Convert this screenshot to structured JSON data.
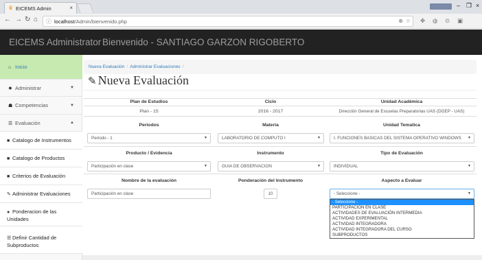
{
  "browser": {
    "tab_title": "EICEMS Admin",
    "tab_close": "×",
    "url_host": "localhost",
    "url_path": "/Admin/bienvenido.php",
    "min": "–",
    "max": "❐",
    "close": "×"
  },
  "navbar": {
    "brand": "EICEMS Administrator",
    "welcome": "Bienvenido - SANTIAGO GARZON RIGOBERTO"
  },
  "sidebar": {
    "items": [
      {
        "label": "Inicio",
        "icon": "home-icon"
      },
      {
        "label": "Administrar",
        "icon": "gear-icon"
      },
      {
        "label": "Competencias",
        "icon": "users-icon"
      },
      {
        "label": "Evaluación",
        "icon": "list-icon"
      },
      {
        "label": "Catalogo de Instrumentos",
        "icon": "book-icon"
      },
      {
        "label": "Catalogo de Productos",
        "icon": "book-icon"
      },
      {
        "label": "Criterios de Evaluación",
        "icon": "book-icon"
      },
      {
        "label": "Administrar Evaluaciones",
        "icon": "edit-icon"
      },
      {
        "label": "Ponderacion de las Unidades",
        "icon": "circle-icon"
      },
      {
        "label": "Definir Cantidad de Subproductos",
        "icon": "list-icon"
      }
    ]
  },
  "breadcrumb": {
    "items": [
      "Nueva Evaluación",
      "Administrar Evaluaciones"
    ],
    "sep": "/"
  },
  "page": {
    "title": "Nueva Evaluación"
  },
  "form": {
    "row1": {
      "headers": [
        "Plan de Estudios",
        "Ciclo",
        "Unidad Académica"
      ],
      "values": [
        "Plan - 15",
        "2016 - 2017",
        "Dirección General de Escuelas Preparatorias UAS (DGEP - UAS)"
      ]
    },
    "row2": {
      "headers": [
        "Periodos",
        "Materia",
        "Unidad Tematica"
      ],
      "selects": [
        "Periodo - 1",
        "LABORATORIO DE COMPUTO I",
        "I. FUNCIONES BASICAS DEL SISTEMA OPERATIVO WINDOWS"
      ]
    },
    "row3": {
      "headers": [
        "Producto / Evidencia",
        "Instrumento",
        "Tipo de Evaluación"
      ],
      "selects": [
        "Participación en clase",
        "GUIA DE OBSERVACION",
        "INDIVIDUAL"
      ]
    },
    "row4": {
      "headers": [
        "Nombre de la evaluación",
        "Ponderación del Instrumento",
        "Aspecto a Evaluar"
      ],
      "name_value": "Participación en clase",
      "ponderacion_value": "10",
      "aspecto_value": "- Seleccione -"
    }
  },
  "aspecto_options": [
    "- Seleccione -",
    "PARTICIPACION EN CLASE",
    "ACTIVIDADES DE EVALUACIÓN INTERMEDIA",
    "ACTIVIDAD EXPERIMENTAL",
    "ACTIVIDAD INTEGRADORA",
    "ACTIVIDAD INTEGRADORA DEL CURSO",
    "SUBPRODUCTOS"
  ],
  "colors": {
    "navbar": "#222222",
    "active_item": "#c7eab0",
    "link": "#337ab7",
    "dropdown_highlight": "#1e90ff"
  }
}
